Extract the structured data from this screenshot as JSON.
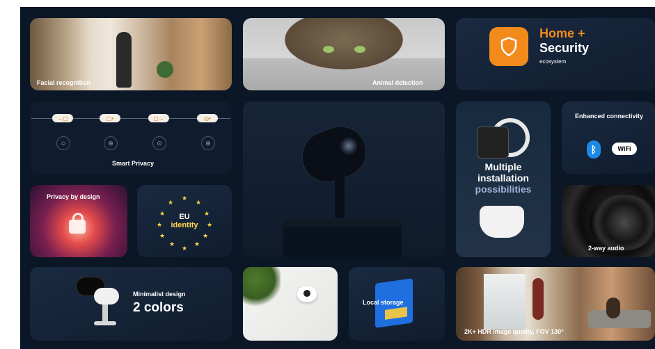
{
  "tiles": {
    "facial": "Facial recognition",
    "animal": "Animal detection",
    "home_title": "Home +",
    "home_title2": "Security",
    "home_sub": "ecosystem",
    "smart_privacy": "Smart Privacy",
    "privacy_design": "Privacy by design",
    "eu": "EU",
    "identity": "identity",
    "installation_1": "Multiple",
    "installation_2": "installation",
    "installation_3": "possibilities",
    "connectivity": "Enhanced connectivity",
    "wifi": "WiFi",
    "audio": "2-way audio",
    "minimalist": "Minimalist design",
    "colors": "2 colors",
    "storage": "Local storage",
    "hdr": "2K+ HDR image quality, FOV 130°"
  },
  "icons": {
    "security": "shield-icon",
    "bluetooth": "bluetooth-icon",
    "lock": "lock-icon"
  },
  "colors": {
    "background": "#0b1626",
    "accent_orange": "#f28a1c",
    "bluetooth_blue": "#1e88e5",
    "eu_yellow": "#ffd64b"
  }
}
